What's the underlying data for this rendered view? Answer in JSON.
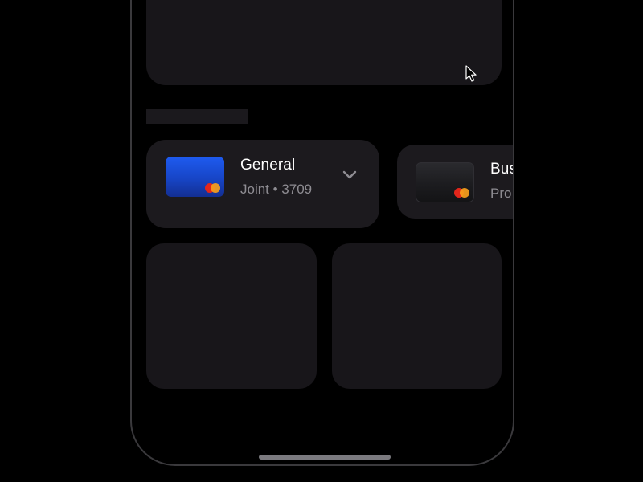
{
  "accounts": [
    {
      "title": "General",
      "subtitle": "Joint • 3709",
      "card_style": "blue",
      "card_brand_icon": "mastercard-icon",
      "expand_icon": "chevron-down-icon"
    },
    {
      "title": "Bus",
      "subtitle": "Pro",
      "card_style": "dark",
      "card_brand_icon": "mastercard-icon"
    }
  ],
  "colors": {
    "background": "#000000",
    "panel": "#18161a",
    "account_card": "#1c1a1e",
    "text_primary": "#ffffff",
    "text_secondary": "#8e8c92",
    "card_blue": "#1e5bf0",
    "mastercard_red": "#e3261b",
    "mastercard_orange": "#f79e1b"
  }
}
